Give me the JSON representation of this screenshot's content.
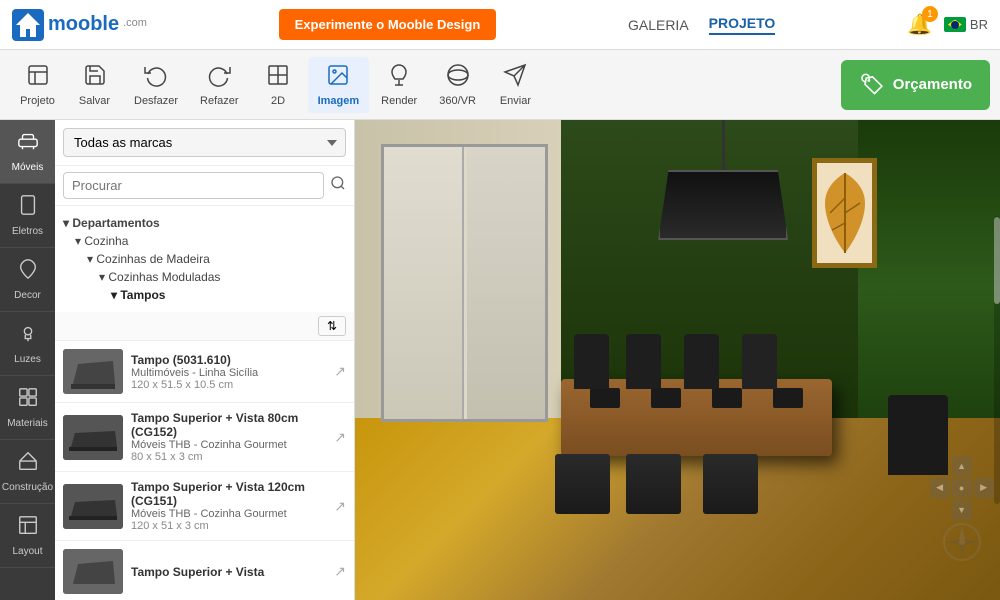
{
  "header": {
    "logo_text": "mooble",
    "logo_com": ".com",
    "try_btn": "Experimente o Mooble Design",
    "nav_galeria": "GALERIA",
    "nav_projeto": "PROJETO",
    "bell_count": "1",
    "lang": "BR"
  },
  "toolbar": {
    "items": [
      {
        "id": "projeto",
        "label": "Projeto",
        "icon": "🏠"
      },
      {
        "id": "salvar",
        "label": "Salvar",
        "icon": "💾"
      },
      {
        "id": "desfazer",
        "label": "Desfazer",
        "icon": "↩"
      },
      {
        "id": "refazer",
        "label": "Refazer",
        "icon": "↪"
      },
      {
        "id": "2d",
        "label": "2D",
        "icon": "⬜"
      },
      {
        "id": "imagem",
        "label": "Imagem",
        "icon": "🖼"
      },
      {
        "id": "render",
        "label": "Render",
        "icon": "☕"
      },
      {
        "id": "360vr",
        "label": "360/VR",
        "icon": "🥽"
      },
      {
        "id": "enviar",
        "label": "Enviar",
        "icon": "✈"
      }
    ],
    "orcamento": "Orçamento"
  },
  "sidebar": {
    "items": [
      {
        "id": "moveis",
        "label": "Móveis",
        "icon": "🛋",
        "active": true
      },
      {
        "id": "eletros",
        "label": "Eletros",
        "icon": "⚡"
      },
      {
        "id": "decor",
        "label": "Decor",
        "icon": "🌸"
      },
      {
        "id": "luzes",
        "label": "Luzes",
        "icon": "💡"
      },
      {
        "id": "materiais",
        "label": "Materiais",
        "icon": "🧱"
      },
      {
        "id": "construcao",
        "label": "Construção",
        "icon": "🏗"
      },
      {
        "id": "layout",
        "label": "Layout",
        "icon": "📐"
      }
    ]
  },
  "panel": {
    "brand_select": "Todas as marcas",
    "search_placeholder": "Procurar",
    "tree": [
      {
        "level": 0,
        "label": "Departamentos",
        "arrow": "▾"
      },
      {
        "level": 1,
        "label": "Cozinha",
        "arrow": "▾"
      },
      {
        "level": 2,
        "label": "Cozinhas de Madeira",
        "arrow": "▾"
      },
      {
        "level": 3,
        "label": "Cozinhas Moduladas",
        "arrow": "▾"
      },
      {
        "level": 4,
        "label": "Tampos",
        "arrow": "▾"
      }
    ],
    "sort_label": "↕",
    "products": [
      {
        "name": "Tampo (5031.610)",
        "brand": "Multimóveis - Linha Sicília",
        "dims": "120 x 51.5 x 10.5 cm",
        "thumb_color": "#555"
      },
      {
        "name": "Tampo Superior + Vista 80cm (CG152)",
        "brand": "Móveis THB - Cozinha Gourmet",
        "dims": "80 x 51 x 3 cm",
        "thumb_color": "#444"
      },
      {
        "name": "Tampo Superior + Vista 120cm (CG151)",
        "brand": "Móveis THB - Cozinha Gourmet",
        "dims": "120 x 51 x 3 cm",
        "thumb_color": "#444"
      },
      {
        "name": "Tampo Superior + Vista",
        "brand": "",
        "dims": "",
        "thumb_color": "#555"
      }
    ]
  }
}
